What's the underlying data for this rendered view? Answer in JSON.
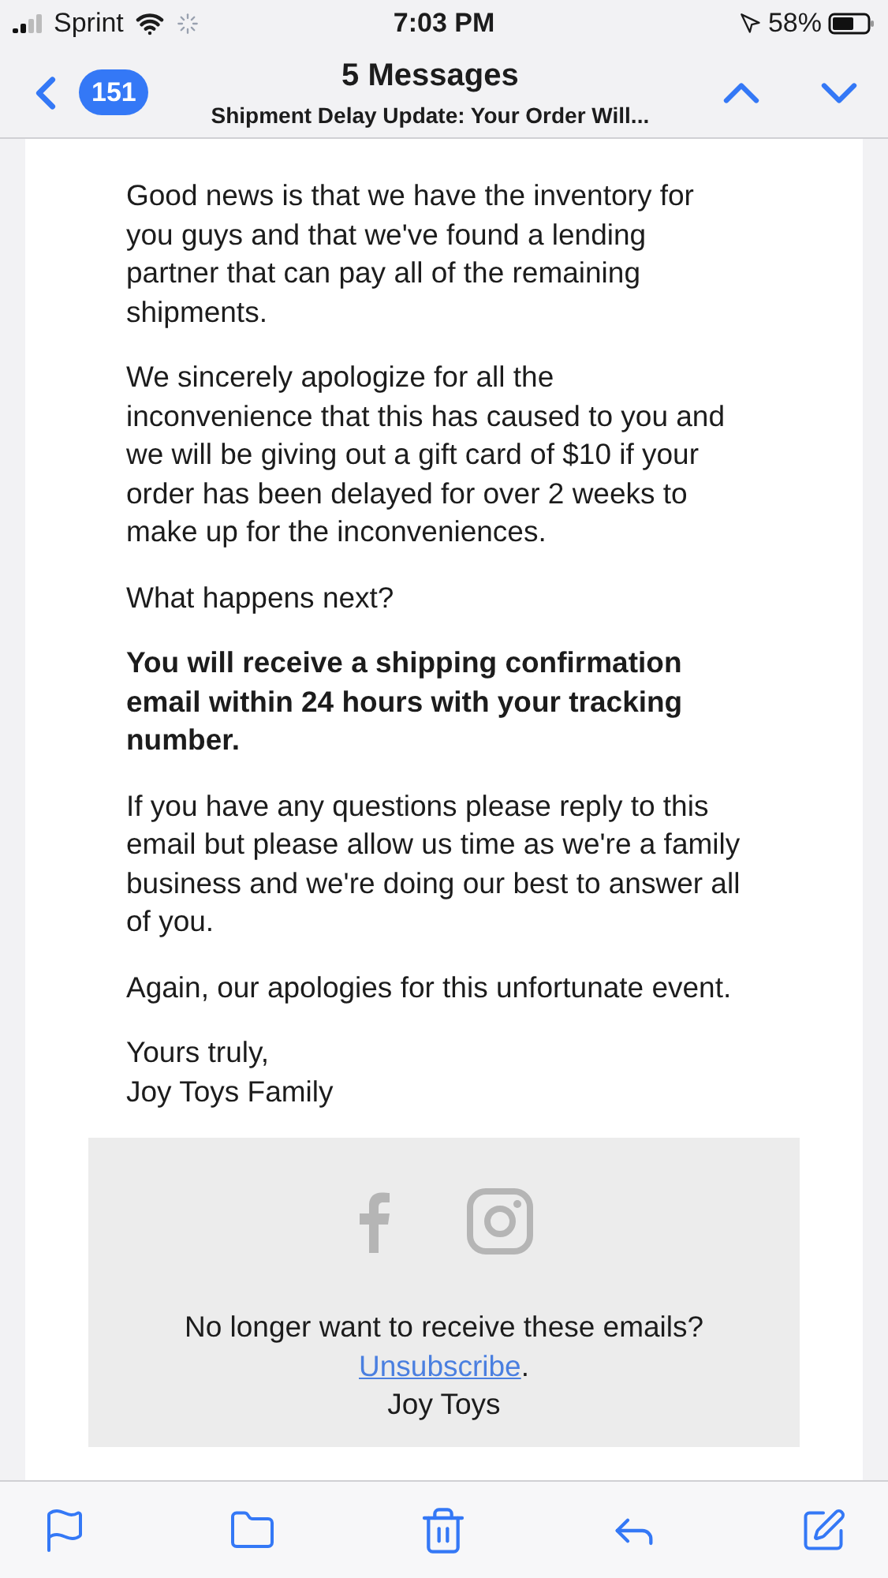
{
  "status_bar": {
    "carrier": "Sprint",
    "time": "7:03 PM",
    "battery": "58%"
  },
  "nav": {
    "back_count": "151",
    "title": "5 Messages",
    "subject": "Shipment Delay Update: Your Order Will..."
  },
  "body": [
    {
      "kind": "text",
      "text": "Good news is that we have the inventory for you guys and that we've found a lending partner that can pay all of the remaining shipments."
    },
    {
      "kind": "text",
      "text": "We sincerely apologize for all the inconvenience that this has caused to you and we will be giving out a gift card of $10 if your order has been delayed for over 2 weeks to make up for the inconveniences."
    },
    {
      "kind": "text",
      "text": "What happens next?"
    },
    {
      "kind": "bold",
      "text": "You will receive a shipping confirmation email within 24 hours with your tracking number."
    },
    {
      "kind": "text",
      "text": "If you have any questions please reply to this email but please allow us time as we're a family business and we're doing our best to answer all of you."
    },
    {
      "kind": "text",
      "text": "Again, our apologies for this unfortunate event."
    }
  ],
  "signoff": [
    "Yours truly,",
    "Joy Toys Family"
  ],
  "footer": {
    "question": "No longer want to receive these emails?",
    "link": "Unsubscribe",
    "after_link": ".",
    "sender": "Joy Toys"
  }
}
